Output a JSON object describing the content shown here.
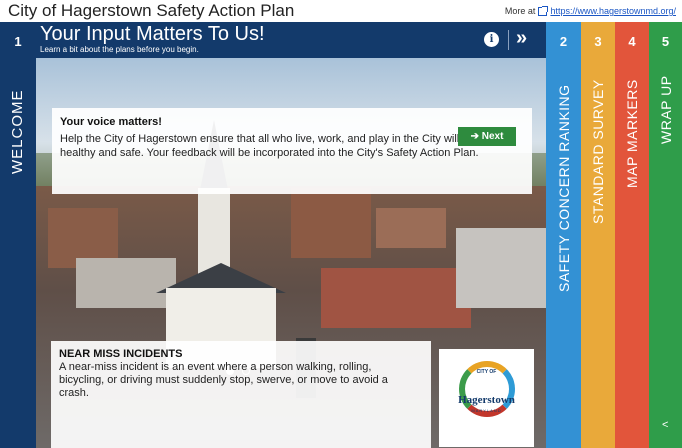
{
  "app": {
    "title": "City of Hagerstown Safety Action Plan",
    "more_at_label": "More at",
    "more_at_link": "https://www.hagerstownmd.org/"
  },
  "tabs": [
    {
      "number": "1",
      "label": "WELCOME",
      "color": "#133a6b"
    },
    {
      "number": "2",
      "label": "SAFETY CONCERN RANKING",
      "color": "#3391d4"
    },
    {
      "number": "3",
      "label": "STANDARD SURVEY",
      "color": "#e9a93a"
    },
    {
      "number": "4",
      "label": "MAP MARKERS",
      "color": "#e2553b"
    },
    {
      "number": "5",
      "label": "WRAP UP",
      "color": "#2f9d4a"
    }
  ],
  "header": {
    "title": "Your Input Matters To Us!",
    "subtitle": "Learn a bit about the plans before you begin.",
    "info_icon": "info-icon",
    "next_icon": "double-chevron-right-icon"
  },
  "intro": {
    "heading": "Your voice matters!",
    "text": "Help the City of Hagerstown ensure that all who live, work, and play in the City will be healthy and safe. Your feedback will be incorporated into the City's Safety Action Plan.",
    "next_button": "➔ Next"
  },
  "carousel": {
    "active_slide": 1,
    "slide_count": 2
  },
  "info_card": {
    "heading": "NEAR MISS INCIDENTS",
    "text": "A near-miss incident is an event where a person walking, rolling, bicycling, or driving must suddenly stop, swerve, or move to avoid a crash."
  },
  "logo": {
    "top_text": "CITY OF",
    "name": "Hagerstown",
    "bottom_text": "MARYLAND"
  },
  "share_icon": "share-icon"
}
